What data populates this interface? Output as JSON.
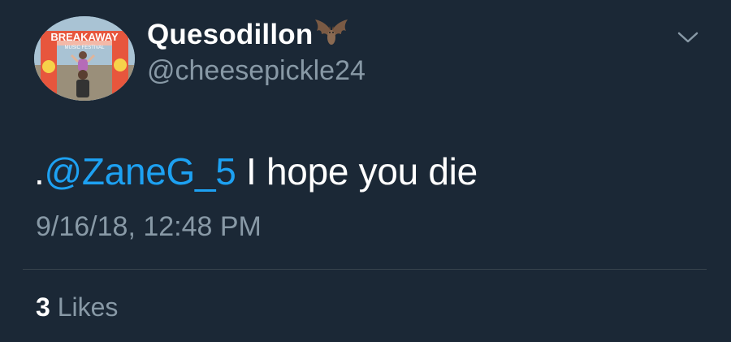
{
  "user": {
    "display_name": "Quesodillon",
    "handle": "@cheesepickle24",
    "name_emoji": "bat-icon",
    "avatar_banner_text": "BREAKAWAY",
    "avatar_banner_subtext": "MUSIC FESTIVAL"
  },
  "tweet": {
    "prefix": ".",
    "mention": "@ZaneG_5",
    "text": " I hope you die",
    "timestamp": "9/16/18, 12:48 PM"
  },
  "stats": {
    "likes_count": "3",
    "likes_label": "Likes"
  },
  "icons": {
    "menu": "chevron-down-icon"
  },
  "colors": {
    "background": "#1b2836",
    "text": "#ffffff",
    "secondary_text": "#8899a6",
    "link": "#1da1f2",
    "divider": "#38444d"
  }
}
